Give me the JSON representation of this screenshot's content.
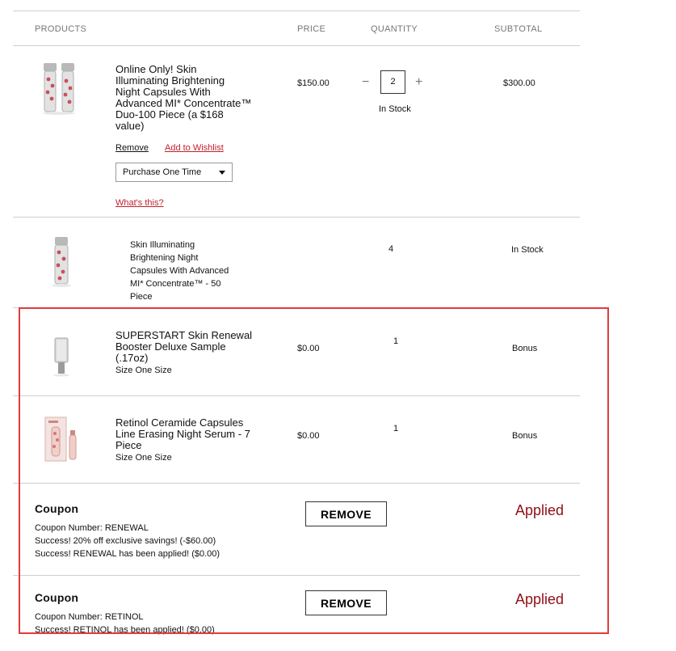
{
  "header": {
    "products": "PRODUCTS",
    "price": "PRICE",
    "quantity": "QUANTITY",
    "subtotal": "SUBTOTAL"
  },
  "item1": {
    "name_lines": [
      "Online Only! Skin",
      "Illuminating Brightening",
      "Night Capsules With",
      "Advanced MI* Concentrate™",
      "Duo-100 Piece (a $168",
      "value)"
    ],
    "price": "$150.00",
    "quantity": "2",
    "decrement": "−",
    "increment": "+",
    "stock": "In Stock",
    "subtotal": "$300.00",
    "remove_label": "Remove",
    "wishlist_label": "Add to Wishlist",
    "purchase_option": "Purchase One Time",
    "whats_this": "What's this?"
  },
  "bundle_item": {
    "name_lines": [
      "Skin Illuminating",
      "Brightening Night",
      "Capsules With Advanced",
      "MI* Concentrate™ - 50",
      "Piece"
    ],
    "quantity": "4",
    "stock": "In Stock"
  },
  "item2": {
    "name_lines": [
      "SUPERSTART Skin Renewal",
      "Booster Deluxe Sample",
      "(.17oz)"
    ],
    "size": "Size One Size",
    "price": "$0.00",
    "quantity": "1",
    "subtotal": "Bonus"
  },
  "item3": {
    "name_lines": [
      "Retinol Ceramide Capsules",
      "Line Erasing Night Serum - 7",
      "Piece"
    ],
    "size": "Size One Size",
    "price": "$0.00",
    "quantity": "1",
    "subtotal": "Bonus"
  },
  "coupon1": {
    "title": "Coupon",
    "number": "Coupon Number: RENEWAL",
    "msg1": "Success! 20% off exclusive savings! (-$60.00)",
    "msg2": "Success! RENEWAL has been applied! ($0.00)",
    "remove_label": "REMOVE",
    "status": "Applied"
  },
  "coupon2": {
    "title": "Coupon",
    "number": "Coupon Number: RETINOL",
    "msg1": "Success! RETINOL has been applied! ($0.00)",
    "remove_label": "REMOVE",
    "status": "Applied"
  },
  "colors": {
    "accent_red": "#c0202e",
    "applied_red": "#8f0f17",
    "highlight_border": "#e23b3b"
  }
}
